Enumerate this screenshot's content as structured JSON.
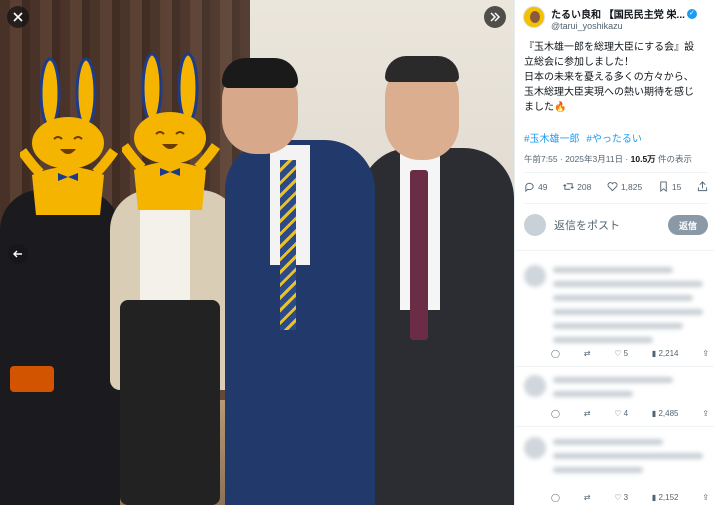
{
  "media": {
    "close_icon": "close-icon",
    "expand_icon": "expand-icon",
    "prev_icon": "arrow-left-icon"
  },
  "post": {
    "author_name": "たるい良和 【国民民主党 栄...",
    "author_handle": "@tarui_yoshikazu",
    "text_lines": [
      "『玉木雄一郎を総理大臣にする会』設",
      "立総会に参加しました！",
      "日本の未来を憂える多くの方々から、",
      "玉木総理大臣実現への熱い期待を感じ",
      "ました🔥"
    ],
    "hashtags": [
      "#玉木雄一郎",
      "#やったるい"
    ],
    "time": "午前7:55 · 2025年3月11日 · ",
    "views_count": "10.5万",
    "views_label": " 件の表示",
    "replies": "49",
    "reposts": "208",
    "likes": "1,825",
    "bookmarks": "15"
  },
  "reply": {
    "placeholder": "返信をポスト",
    "button": "返信"
  },
  "comments": [
    {
      "likes": "5",
      "views": "2,214"
    },
    {
      "likes": "4",
      "views": "2,485"
    },
    {
      "likes": "3",
      "views": "2,152"
    }
  ],
  "colors": {
    "accent": "#1d9bf0",
    "muted_text": "#536471",
    "rabbit": "#f4b400"
  }
}
